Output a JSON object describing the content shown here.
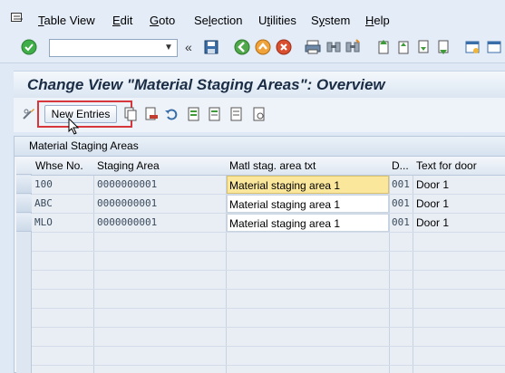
{
  "menu": {
    "items": [
      "Table View",
      "Edit",
      "Goto",
      "Selection",
      "Utilities",
      "System",
      "Help"
    ],
    "underlined": [
      "T",
      "E",
      "G",
      "l",
      "t",
      "y",
      "H"
    ]
  },
  "toolbar": {
    "command_value": "",
    "back_glyph": "«"
  },
  "page": {
    "title": "Change View \"Material Staging Areas\": Overview"
  },
  "app_toolbar": {
    "new_entries_label": "New Entries"
  },
  "table": {
    "caption": "Material Staging Areas",
    "columns": [
      "Whse No.",
      "Staging Area",
      "Matl stag. area txt",
      "D...",
      "Text for door"
    ],
    "rows": [
      {
        "whse": "100",
        "area": "0000000001",
        "text": "Material staging area 1",
        "door": "001",
        "door_text": "Door 1"
      },
      {
        "whse": "ABC",
        "area": "0000000001",
        "text": "Material staging area 1",
        "door": "001",
        "door_text": "Door 1"
      },
      {
        "whse": "MLO",
        "area": "0000000001",
        "text": "Material staging area 1",
        "door": "001",
        "door_text": "Door 1"
      }
    ]
  },
  "colors": {
    "accent_red": "#d8363d",
    "active_field": "#fbe79c",
    "title": "#1b2c45"
  }
}
